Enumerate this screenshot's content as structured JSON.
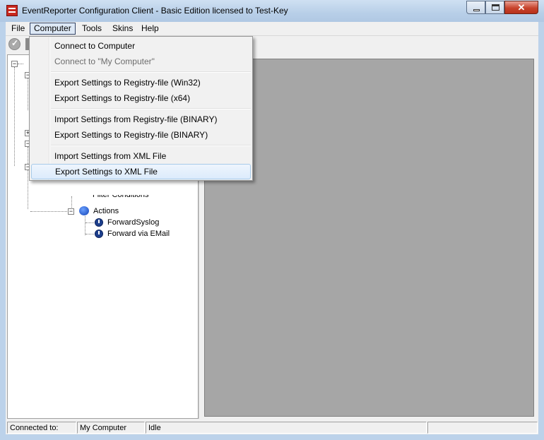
{
  "window": {
    "title": "EventReporter Configuration Client - Basic Edition licensed to Test-Key",
    "close_glyph": "✕"
  },
  "menubar": {
    "items": [
      "File",
      "Computer",
      "Tools",
      "Skins",
      "Help"
    ]
  },
  "computer_menu": {
    "items": [
      {
        "label": "Connect to Computer",
        "enabled": true
      },
      {
        "label": "Connect to \"My Computer\"",
        "enabled": false
      },
      {
        "label": "Export Settings to Registry-file (Win32)",
        "enabled": true
      },
      {
        "label": "Export Settings to Registry-file (x64)",
        "enabled": true
      },
      {
        "label": "Import Settings from Registry-file (BINARY)",
        "enabled": true
      },
      {
        "label": "Export Settings to Registry-file (BINARY)",
        "enabled": true
      },
      {
        "label": "Import Settings from XML File",
        "enabled": true
      },
      {
        "label": "Export Settings to XML File",
        "enabled": true,
        "highlighted": true
      }
    ]
  },
  "tree": {
    "partial_label": "Filter Conditions",
    "actions_label": "Actions",
    "actions_children": [
      "ForwardSyslog",
      "Forward via EMail"
    ]
  },
  "statusbar": {
    "connected_label": "Connected to:",
    "computer_name": "My Computer",
    "state": "Idle"
  },
  "colors": {
    "main_pane": "#a6a6a6",
    "highlight": "#dcebfc",
    "close_button": "#c7432c"
  }
}
